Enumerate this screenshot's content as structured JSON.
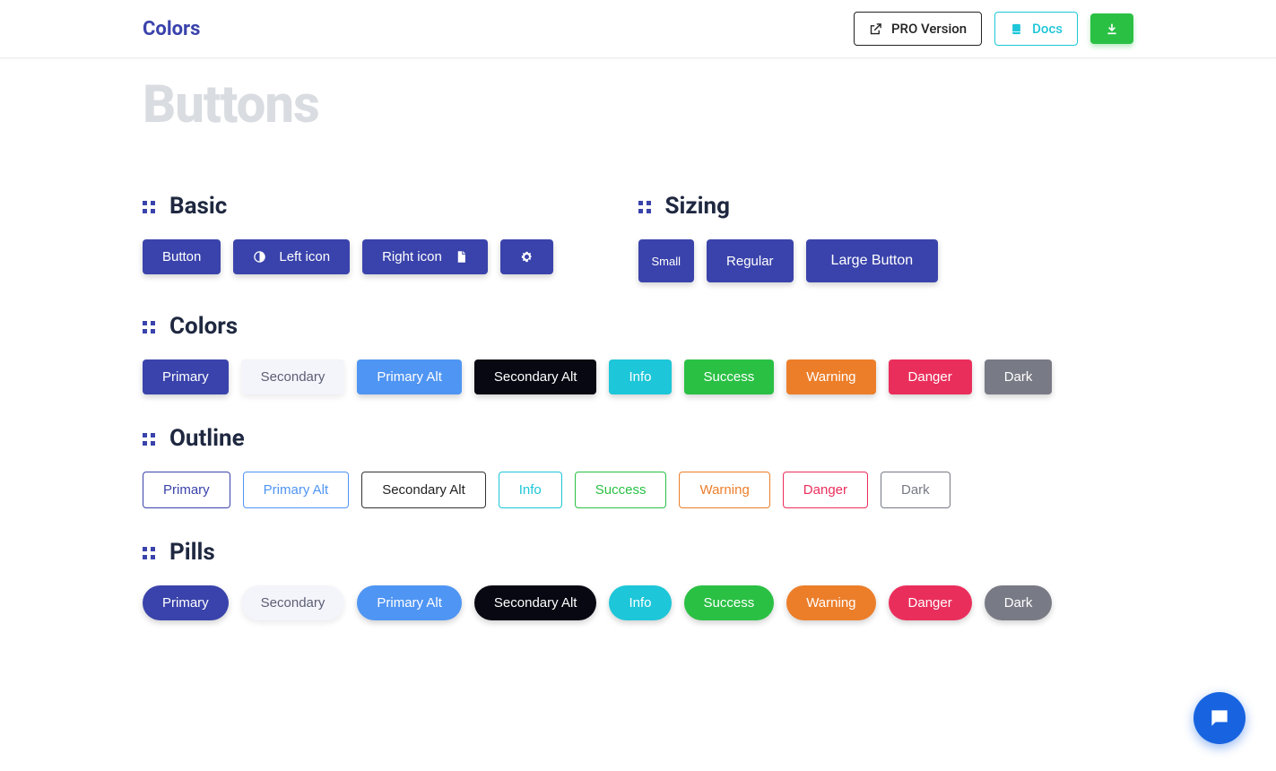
{
  "nav": {
    "brand": "Colors",
    "pro": "PRO Version",
    "docs": "Docs"
  },
  "page": {
    "title": "Buttons"
  },
  "sections": {
    "basic": {
      "title": "Basic"
    },
    "sizing": {
      "title": "Sizing"
    },
    "colors": {
      "title": "Colors"
    },
    "outline": {
      "title": "Outline"
    },
    "pills": {
      "title": "Pills"
    }
  },
  "basic": {
    "button": "Button",
    "left_icon": "Left icon",
    "right_icon": "Right icon"
  },
  "sizing": {
    "small": "Small",
    "regular": "Regular",
    "large": "Large Button"
  },
  "labels": {
    "primary": "Primary",
    "secondary": "Secondary",
    "primary_alt": "Primary Alt",
    "secondary_alt": "Secondary Alt",
    "info": "Info",
    "success": "Success",
    "warning": "Warning",
    "danger": "Danger",
    "dark": "Dark"
  }
}
